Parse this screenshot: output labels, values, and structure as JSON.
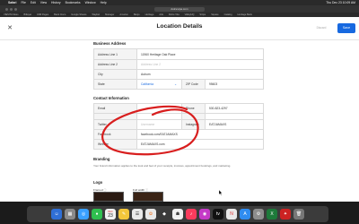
{
  "menubar": {
    "items": [
      "Safari",
      "File",
      "Edit",
      "View",
      "History",
      "Bookmarks",
      "Window",
      "Help"
    ],
    "clock": "Thu Dec 23 10:09 AM"
  },
  "browser": {
    "url": "dolcevipa.com"
  },
  "favorites": [
    "VIESITA Mess",
    "Bitlayar",
    "FAB Pages",
    "Bank Cisco",
    "Google Sheets",
    "Wayfair",
    "Manager",
    "Amazon",
    "Banjo",
    "Heritage",
    "Ads",
    "Dolce Vita",
    "ValleyHQ",
    "Stripe",
    "Square",
    "Catalog",
    "Heritage Bank"
  ],
  "page": {
    "title": "Location Details",
    "discard_label": "Discard",
    "save_label": "Save"
  },
  "business_address": {
    "heading": "Business Address",
    "address_line_1_label": "Address Line 1",
    "address_line_1_value": "11960 Heritage Oak Place",
    "address_line_2_label": "Address Line 2",
    "address_line_2_placeholder": "Address Line 2",
    "city_label": "City",
    "city_value": "Auburn",
    "state_label": "State",
    "state_value": "California",
    "zip_label": "ZIP Code",
    "zip_value": "95603"
  },
  "contact_information": {
    "heading": "Contact Information",
    "email_label": "Email",
    "email_value": "",
    "phone_label": "Phone",
    "phone_value": "530-823-4297",
    "twitter_label": "Twitter",
    "twitter_placeholder": "Username",
    "instagram_label": "Instagram",
    "instagram_value": "EATJAMAXS",
    "facebook_label": "Facebook",
    "facebook_value": "facebook.com/EATJAMAXS",
    "website_label": "Website",
    "website_value": "EATJAMAXS.com"
  },
  "branding": {
    "heading": "Branding",
    "description": "Your brand information applies to the look and feel of your receipts, invoices, appointment bookings, and marketing."
  },
  "logo": {
    "heading": "Logo",
    "framed_label": "Framed",
    "full_width_label": "Full width"
  },
  "dock": {
    "calendar_month": "DEC",
    "calendar_day": "23"
  },
  "colors": {
    "accent": "#1769e0",
    "annotation": "#d81e1e"
  }
}
